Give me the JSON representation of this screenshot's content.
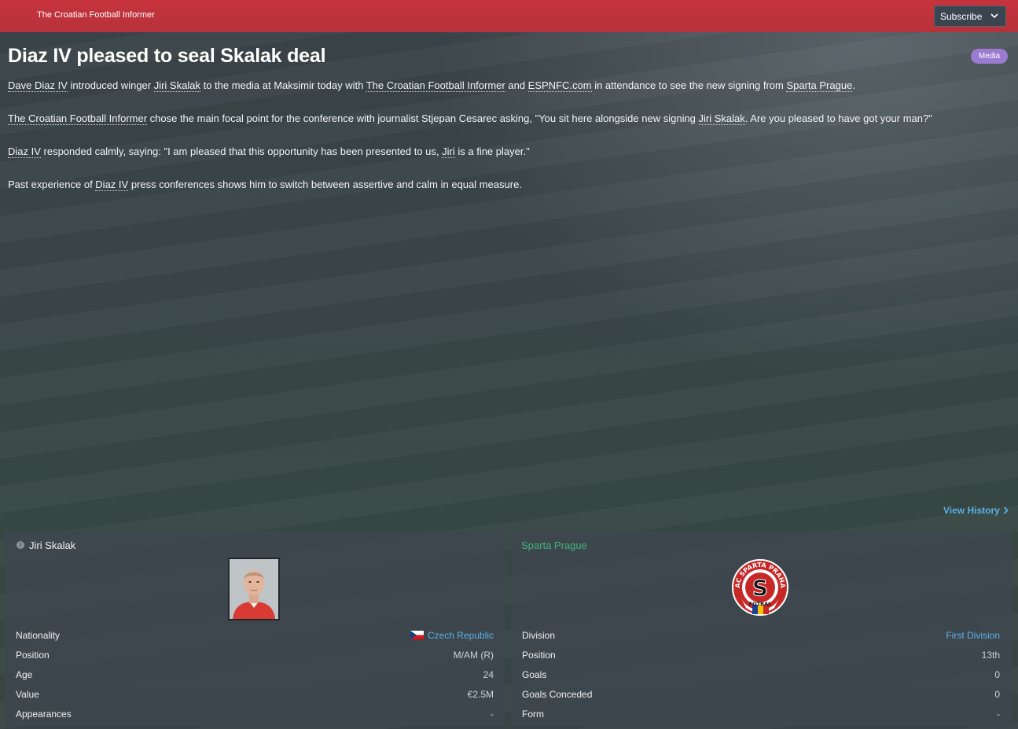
{
  "header": {
    "source": "The Croatian Football Informer",
    "subscribe_label": "Subscribe",
    "colors": {
      "bar": "#c6333c",
      "badge": "#9b7bd2",
      "link": "#5cb0e6",
      "club": "#3fb57e"
    }
  },
  "article": {
    "headline": "Diaz IV pleased to seal Skalak deal",
    "badge": "Media",
    "p1": {
      "t1": "Dave Diaz IV",
      "t2": " introduced winger ",
      "t3": "Jiri Skalak",
      "t4": " to the media at Maksimir today with ",
      "t5": "The Croatian Football Informer",
      "t6": " and ",
      "t7": "ESPNFC.com",
      "t8": " in attendance to see the new signing from ",
      "t9": "Sparta Prague",
      "t10": "."
    },
    "p2": {
      "t1": "The Croatian Football Informer",
      "t2": " chose the main focal point for the conference with journalist Stjepan Cesarec asking, \"You sit here alongside new signing ",
      "t3": "Jiri Skalak",
      "t4": ". Are you pleased to have got your man?\""
    },
    "p3": {
      "t1": "Diaz IV",
      "t2": " responded calmly, saying: \"I am pleased that this opportunity has been presented to us, ",
      "t3": "Jiri",
      "t4": " is a fine player.\""
    },
    "p4": {
      "t1": "Past experience of ",
      "t2": "Diaz IV",
      "t3": " press conferences shows him to switch between assertive and calm in equal measure."
    }
  },
  "view_history": "View History",
  "player": {
    "name": "Jiri Skalak",
    "rows": [
      {
        "label": "Nationality",
        "value": "Czech Republic"
      },
      {
        "label": "Position",
        "value": "M/AM (R)"
      },
      {
        "label": "Age",
        "value": "24"
      },
      {
        "label": "Value",
        "value": "€2.5M"
      },
      {
        "label": "Appearances",
        "value": "-"
      }
    ]
  },
  "club": {
    "name": "Sparta Prague",
    "crest_text": "AC SPARTA PRAHA",
    "crest_letter": "S",
    "crest_bottom": "FOTBAL",
    "rows": [
      {
        "label": "Division",
        "value": "First Division"
      },
      {
        "label": "Position",
        "value": "13th"
      },
      {
        "label": "Goals",
        "value": "0"
      },
      {
        "label": "Goals Conceded",
        "value": "0"
      },
      {
        "label": "Form",
        "value": "-"
      }
    ]
  }
}
